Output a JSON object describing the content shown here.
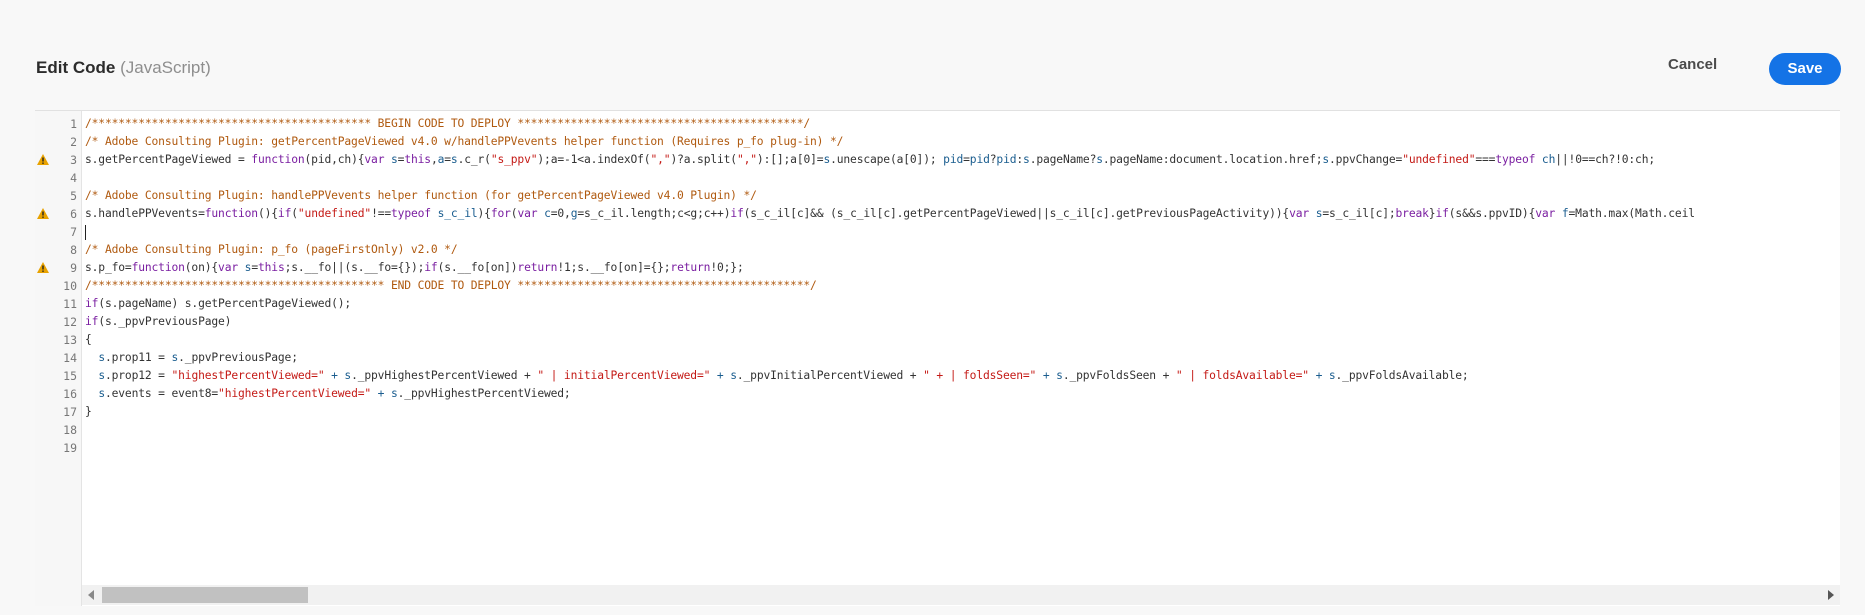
{
  "header": {
    "title": "Edit Code",
    "language": "(JavaScript)",
    "cancel_label": "Cancel",
    "save_label": "Save"
  },
  "editor": {
    "line_numbers": [
      "1",
      "2",
      "3",
      "4",
      "5",
      "6",
      "7",
      "8",
      "9",
      "10",
      "11",
      "12",
      "13",
      "14",
      "15",
      "16",
      "17",
      "18",
      "19"
    ],
    "warning_lines": [
      3,
      6,
      9
    ],
    "lines": [
      [
        [
          "cm",
          "/****************************************** BEGIN CODE TO DEPLOY *******************************************/"
        ]
      ],
      [
        [
          "cm",
          "/* Adobe Consulting Plugin: getPercentPageViewed v4.0 w/handlePPVevents helper function (Requires p_fo plug-in) */"
        ]
      ],
      [
        [
          "",
          "s.getPercentPageViewed = "
        ],
        [
          "kw",
          "function"
        ],
        [
          "",
          "(pid,ch){"
        ],
        [
          "kw",
          "var"
        ],
        [
          "var",
          " s"
        ],
        [
          "",
          "="
        ],
        [
          "kw",
          "this"
        ],
        [
          "",
          ","
        ],
        [
          "var",
          "a"
        ],
        [
          "",
          "="
        ],
        [
          "var",
          "s"
        ],
        [
          "",
          ".c_r("
        ],
        [
          "str",
          "\"s_ppv\""
        ],
        [
          "",
          ");a=-1<a.indexOf("
        ],
        [
          "str",
          "\",\""
        ],
        [
          "",
          ")?a.split("
        ],
        [
          "str",
          "\",\""
        ],
        [
          "",
          "):[];a[0]="
        ],
        [
          "var",
          "s"
        ],
        [
          "",
          ".unescape(a[0]); "
        ],
        [
          "var",
          "pid"
        ],
        [
          "",
          "="
        ],
        [
          "var",
          "pid"
        ],
        [
          "",
          "?"
        ],
        [
          "var",
          "pid"
        ],
        [
          "",
          ":"
        ],
        [
          "var",
          "s"
        ],
        [
          "",
          ".pageName?"
        ],
        [
          "var",
          "s"
        ],
        [
          "",
          ".pageName:document.location.href;"
        ],
        [
          "var",
          "s"
        ],
        [
          "",
          ".ppvChange="
        ],
        [
          "str",
          "\"undefined\""
        ],
        [
          "",
          "==="
        ],
        [
          "kw",
          "typeof"
        ],
        [
          "",
          ""
        ],
        [
          "var",
          " ch"
        ],
        [
          "",
          "||!0==ch?!0:ch;"
        ]
      ],
      [],
      [
        [
          "cm",
          "/* Adobe Consulting Plugin: handlePPVevents helper function (for getPercentPageViewed v4.0 Plugin) */"
        ]
      ],
      [
        [
          "",
          "s.handlePPVevents="
        ],
        [
          "kw",
          "function"
        ],
        [
          "",
          "(){"
        ],
        [
          "kw",
          "if"
        ],
        [
          "",
          "("
        ],
        [
          "str",
          "\"undefined\""
        ],
        [
          "",
          "!=="
        ],
        [
          "kw",
          "typeof"
        ],
        [
          "",
          ""
        ],
        [
          "var",
          " s_c_il"
        ],
        [
          "",
          "){"
        ],
        [
          "kw",
          "for"
        ],
        [
          "",
          "("
        ],
        [
          "kw",
          "var"
        ],
        [
          "",
          ""
        ],
        [
          "var",
          " c"
        ],
        [
          "",
          "=0,"
        ],
        [
          "var",
          "g"
        ],
        [
          "",
          "=s_c_il.length;c<g;c++)"
        ],
        [
          "kw",
          "if"
        ],
        [
          "",
          "(s_c_il[c]&& (s_c_il[c].getPercentPageViewed||s_c_il[c].getPreviousPageActivity)){"
        ],
        [
          "kw",
          "var"
        ],
        [
          "",
          ""
        ],
        [
          "var",
          " s"
        ],
        [
          "",
          "=s_c_il[c];"
        ],
        [
          "kw",
          "break"
        ],
        [
          "",
          "}"
        ],
        [
          "kw",
          "if"
        ],
        [
          "",
          "(s&&s.ppvID){"
        ],
        [
          "kw",
          "var"
        ],
        [
          "",
          ""
        ],
        [
          "var",
          " f"
        ],
        [
          "",
          "=Math.max(Math.ceil"
        ]
      ],
      [
        [
          "caret",
          ""
        ]
      ],
      [
        [
          "cm",
          "/* Adobe Consulting Plugin: p_fo (pageFirstOnly) v2.0 */"
        ]
      ],
      [
        [
          "",
          "s.p_fo="
        ],
        [
          "kw",
          "function"
        ],
        [
          "",
          "(on){"
        ],
        [
          "kw",
          "var"
        ],
        [
          "",
          ""
        ],
        [
          "var",
          " s"
        ],
        [
          "",
          "="
        ],
        [
          "kw",
          "this"
        ],
        [
          "",
          ";s.__fo||(s.__fo={});"
        ],
        [
          "kw",
          "if"
        ],
        [
          "",
          "(s.__fo[on])"
        ],
        [
          "kw",
          "return"
        ],
        [
          "",
          "!1;s.__fo[on]={};"
        ],
        [
          "kw",
          "return"
        ],
        [
          "",
          "!0;};"
        ]
      ],
      [
        [
          "cm",
          "/******************************************** END CODE TO DEPLOY ********************************************/"
        ]
      ],
      [
        [
          "kw",
          "if"
        ],
        [
          "",
          "(s.pageName) s.getPercentPageViewed();"
        ]
      ],
      [
        [
          "kw",
          "if"
        ],
        [
          "",
          "(s._ppvPreviousPage)"
        ]
      ],
      [
        [
          "",
          "{"
        ]
      ],
      [
        [
          "",
          "  "
        ],
        [
          "var",
          "s"
        ],
        [
          "",
          ".prop11 = "
        ],
        [
          "var",
          "s"
        ],
        [
          "",
          "._ppvPreviousPage;"
        ]
      ],
      [
        [
          "",
          "  "
        ],
        [
          "var",
          "s"
        ],
        [
          "",
          ".prop12 = "
        ],
        [
          "str",
          "\"highestPercentViewed=\""
        ],
        [
          "",
          ""
        ],
        [
          "var",
          " + s"
        ],
        [
          "",
          "._ppvHighestPercentViewed + "
        ],
        [
          "str",
          "\" | initialPercentViewed=\""
        ],
        [
          "",
          ""
        ],
        [
          "var",
          " + s"
        ],
        [
          "",
          "._ppvInitialPercentViewed + "
        ],
        [
          "str",
          "\" + | foldsSeen=\""
        ],
        [
          "",
          ""
        ],
        [
          "var",
          " + s"
        ],
        [
          "",
          "._ppvFoldsSeen + "
        ],
        [
          "str",
          "\" | foldsAvailable=\""
        ],
        [
          "",
          ""
        ],
        [
          "var",
          " + s"
        ],
        [
          "",
          "._ppvFoldsAvailable;"
        ]
      ],
      [
        [
          "",
          "  "
        ],
        [
          "var",
          "s"
        ],
        [
          "",
          ".events = event8="
        ],
        [
          "str",
          "\"highestPercentViewed=\""
        ],
        [
          "",
          ""
        ],
        [
          "var",
          " + s"
        ],
        [
          "",
          "._ppvHighestPercentViewed;"
        ]
      ],
      [
        [
          "",
          "}"
        ]
      ],
      [],
      []
    ]
  }
}
